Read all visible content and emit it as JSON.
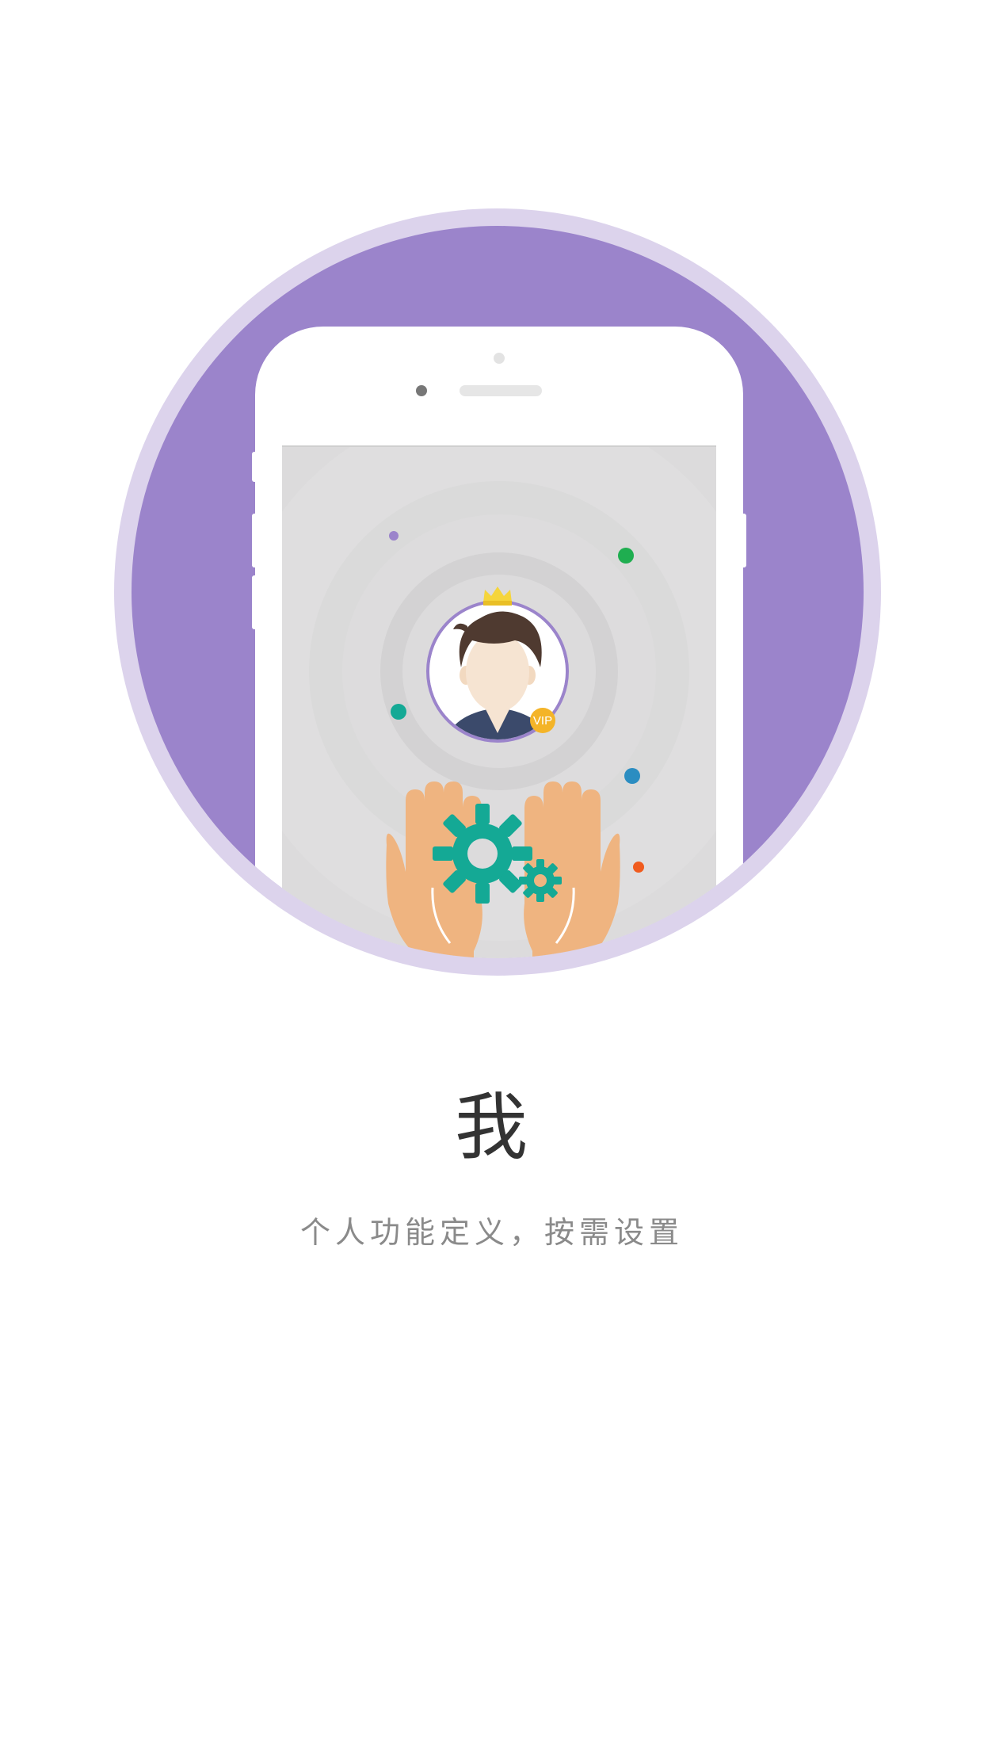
{
  "guide": {
    "title": "我",
    "subtitle": "个人功能定义，按需设置"
  },
  "badge": {
    "vip_text": "VIP"
  },
  "colors": {
    "background": "#ffffff",
    "circle_outer": "#dcd3ec",
    "circle_inner": "#9b84cb",
    "gear": "#14a995",
    "hands": "#efb480",
    "crown": "#f5d53c",
    "vip_badge": "#f4b428",
    "title_text": "#333333",
    "subtitle_text": "#8a8a8a"
  },
  "icons": [
    "phone-illustration",
    "avatar-icon",
    "crown-icon",
    "vip-badge-icon",
    "gear-icon",
    "hands-icon"
  ]
}
